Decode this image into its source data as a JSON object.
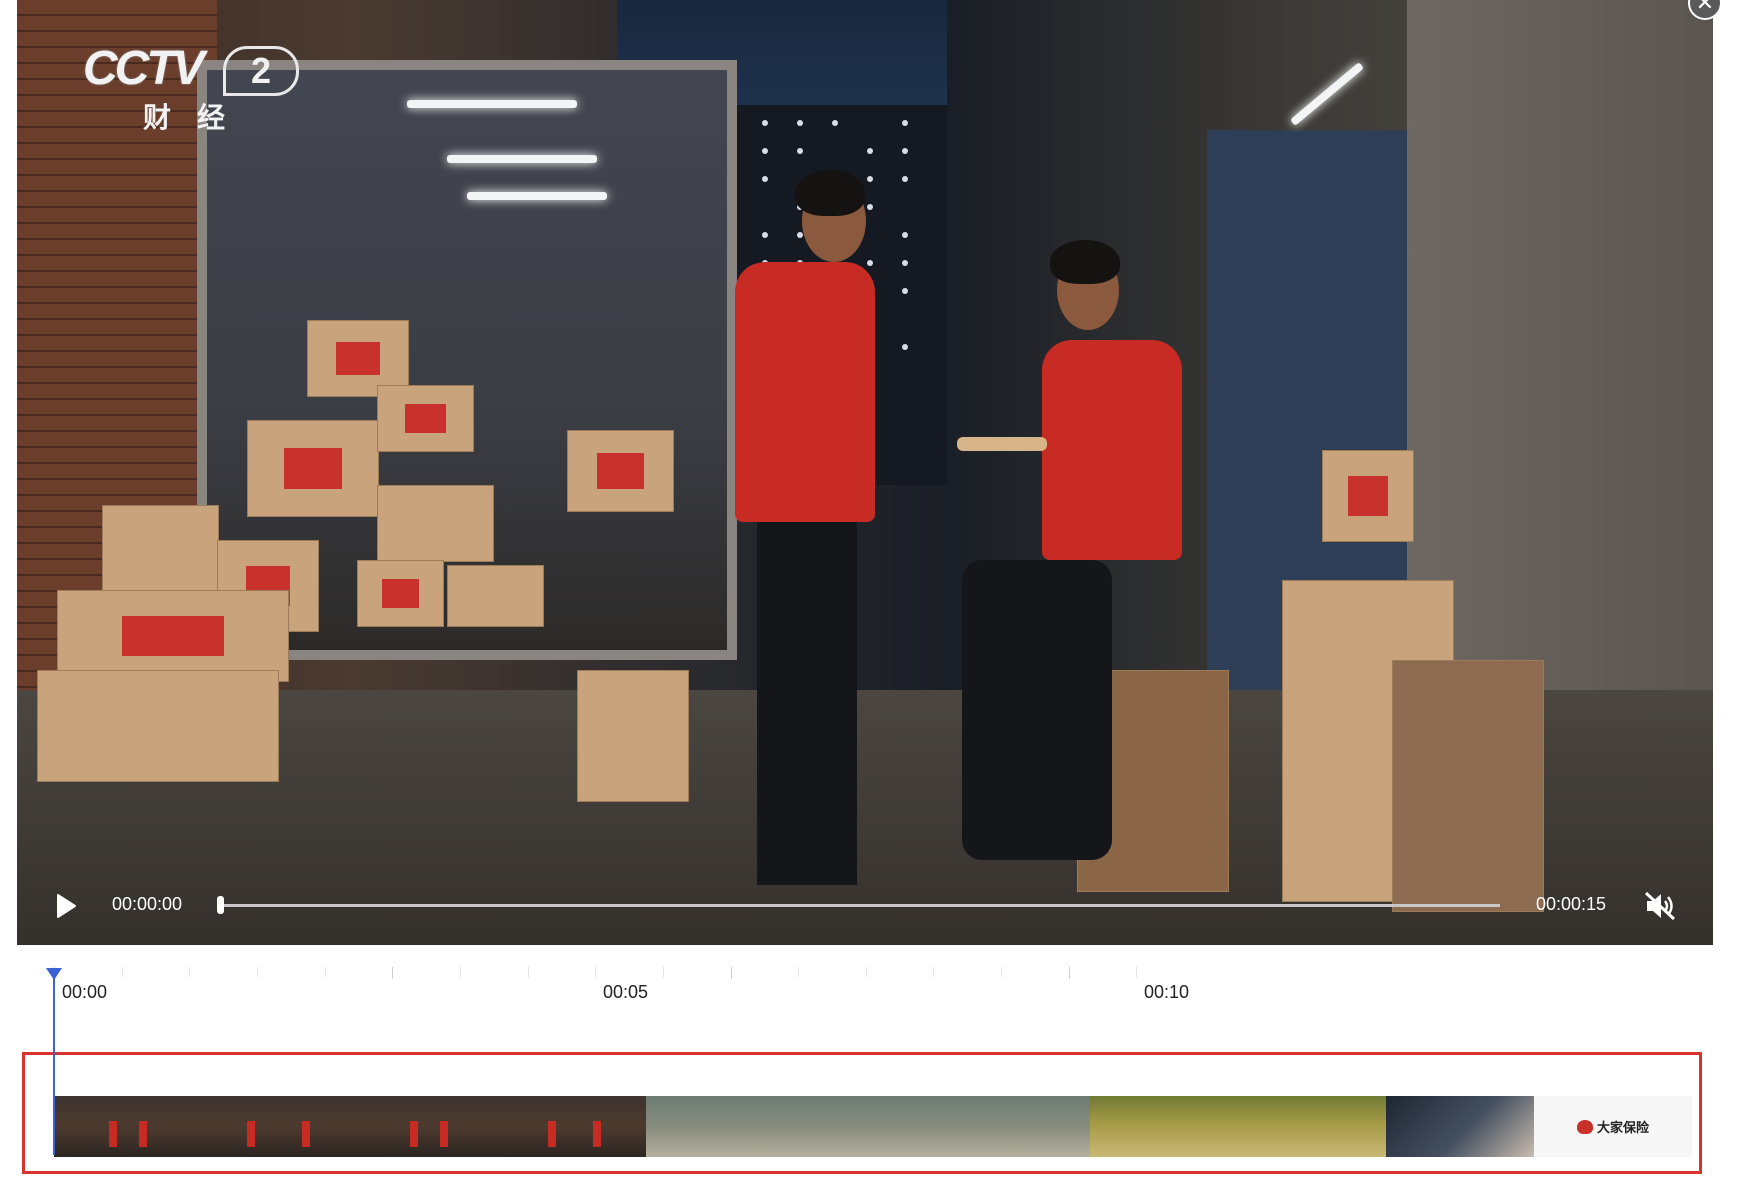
{
  "dialog": {
    "close_glyph": "✕"
  },
  "video": {
    "channel_logo": {
      "main": "CCTV",
      "number": "2",
      "sub": "财经"
    },
    "current_time": "00:00:00",
    "total_time": "00:00:15",
    "progress": 0,
    "muted": true
  },
  "timeline": {
    "tick_labels": [
      "00:00",
      "00:05",
      "00:10"
    ],
    "playhead_time": "00:00",
    "end_card_brand": "大家保险",
    "accent_color": "#3b63d8",
    "selection_color": "#d9332e"
  },
  "icons": {
    "play": "play-icon",
    "mute": "volume-muted-icon",
    "close": "close-icon"
  }
}
